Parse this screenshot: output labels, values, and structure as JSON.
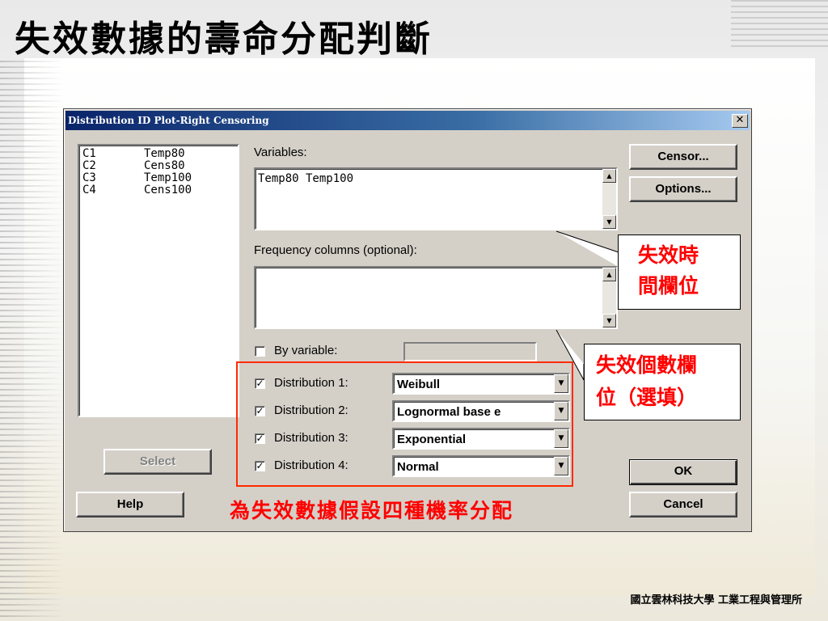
{
  "slide": {
    "title": "失效數據的壽命分配判斷",
    "footer": "國立雲林科技大學 工業工程與管理所"
  },
  "dialog": {
    "title": "Distribution ID Plot-Right Censoring",
    "close_glyph": "✕",
    "columns": [
      {
        "id": "C1",
        "name": "Temp80"
      },
      {
        "id": "C2",
        "name": "Cens80"
      },
      {
        "id": "C3",
        "name": "Temp100"
      },
      {
        "id": "C4",
        "name": "Cens100"
      }
    ],
    "variables_label": "Variables:",
    "variables_value": "Temp80 Temp100",
    "frequency_label": "Frequency columns (optional):",
    "frequency_value": "",
    "by_variable_label": "By variable:",
    "by_variable_checked": false,
    "distributions": [
      {
        "label": "Distribution 1:",
        "checked": true,
        "value": "Weibull"
      },
      {
        "label": "Distribution 2:",
        "checked": true,
        "value": "Lognormal base e"
      },
      {
        "label": "Distribution 3:",
        "checked": true,
        "value": "Exponential"
      },
      {
        "label": "Distribution 4:",
        "checked": true,
        "value": "Normal"
      }
    ],
    "buttons": {
      "censor": "Censor...",
      "options": "Options...",
      "select": "Select",
      "help": "Help",
      "ok": "OK",
      "cancel": "Cancel"
    }
  },
  "annotations": {
    "variables_callout": [
      "失效時",
      "間欄位"
    ],
    "frequency_callout": [
      "失效個數欄",
      "位（選填）"
    ],
    "distribution_note": "為失效數據假設四種機率分配"
  },
  "colors": {
    "annotation_red": "#ff0000",
    "frame_red": "#ff2a00",
    "titlebar_start": "#0a246a",
    "titlebar_end": "#a6caf0"
  }
}
